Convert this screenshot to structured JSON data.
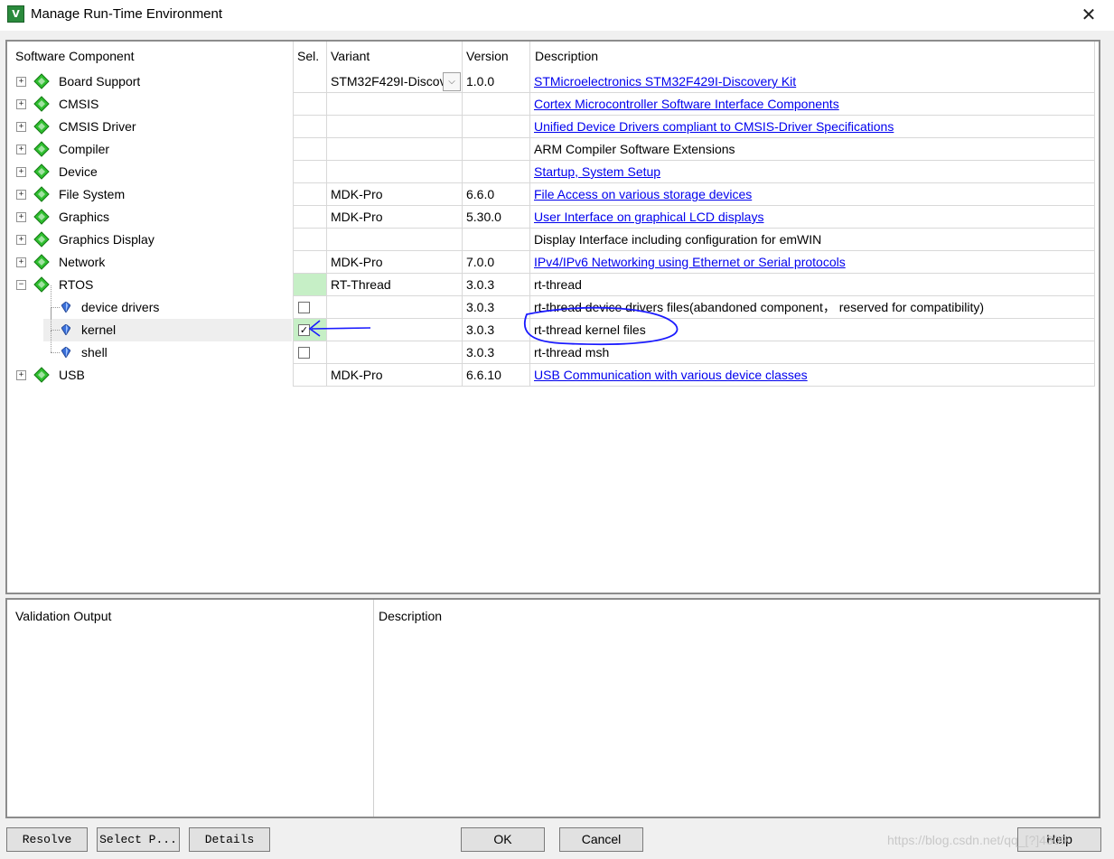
{
  "window": {
    "title": "Manage Run-Time Environment",
    "icon_text": "V"
  },
  "columns": {
    "component": "Software Component",
    "sel": "Sel.",
    "variant": "Variant",
    "version": "Version",
    "description": "Description"
  },
  "rows": [
    {
      "name": "Board Support",
      "variant": "STM32F429I-Discov",
      "version": "1.0.0",
      "description": "STMicroelectronics STM32F429I-Discovery Kit",
      "is_link": true
    },
    {
      "name": "CMSIS",
      "variant": "",
      "version": "",
      "description": "Cortex Microcontroller Software Interface Components",
      "is_link": true
    },
    {
      "name": "CMSIS Driver",
      "variant": "",
      "version": "",
      "description": "Unified Device Drivers compliant to CMSIS-Driver Specifications",
      "is_link": true
    },
    {
      "name": "Compiler",
      "variant": "",
      "version": "",
      "description": "ARM Compiler Software Extensions",
      "is_link": false
    },
    {
      "name": "Device",
      "variant": "",
      "version": "",
      "description": "Startup, System Setup",
      "is_link": true
    },
    {
      "name": "File System",
      "variant": "MDK-Pro",
      "version": "6.6.0",
      "description": "File Access on various storage devices",
      "is_link": true
    },
    {
      "name": "Graphics",
      "variant": "MDK-Pro",
      "version": "5.30.0",
      "description": "User Interface on graphical LCD displays",
      "is_link": true
    },
    {
      "name": "Graphics Display",
      "variant": "",
      "version": "",
      "description": "Display Interface including configuration for emWIN",
      "is_link": false
    },
    {
      "name": "Network",
      "variant": "MDK-Pro",
      "version": "7.0.0",
      "description": "IPv4/IPv6 Networking using Ethernet or Serial protocols",
      "is_link": true
    },
    {
      "name": "RTOS",
      "variant": "RT-Thread",
      "version": "3.0.3",
      "description": "rt-thread",
      "is_link": false
    },
    {
      "name": "device drivers",
      "variant": "",
      "version": "3.0.3",
      "description": "rt-thread device drivers files(abandoned component， reserved for compatibility)",
      "is_link": false,
      "checked": false
    },
    {
      "name": "kernel",
      "variant": "",
      "version": "3.0.3",
      "description": "rt-thread kernel files",
      "is_link": false,
      "checked": true
    },
    {
      "name": "shell",
      "variant": "",
      "version": "3.0.3",
      "description": "rt-thread msh",
      "is_link": false,
      "checked": false
    },
    {
      "name": "USB",
      "variant": "MDK-Pro",
      "version": "6.6.10",
      "description": "USB Communication with various device classes",
      "is_link": true
    }
  ],
  "validation": {
    "output_header": "Validation Output",
    "description_header": "Description"
  },
  "buttons": {
    "resolve": "Resolve",
    "select": "Select P...",
    "details": "Details",
    "ok": "OK",
    "cancel": "Cancel",
    "help": "Help"
  },
  "watermark": "https://blog.csdn.net/qq_[?]4309",
  "colors": {
    "link": "#0000ee",
    "sel_green": "#c6efc6",
    "annotation": "#1a1aff",
    "diamond": "#2fbf2f"
  }
}
